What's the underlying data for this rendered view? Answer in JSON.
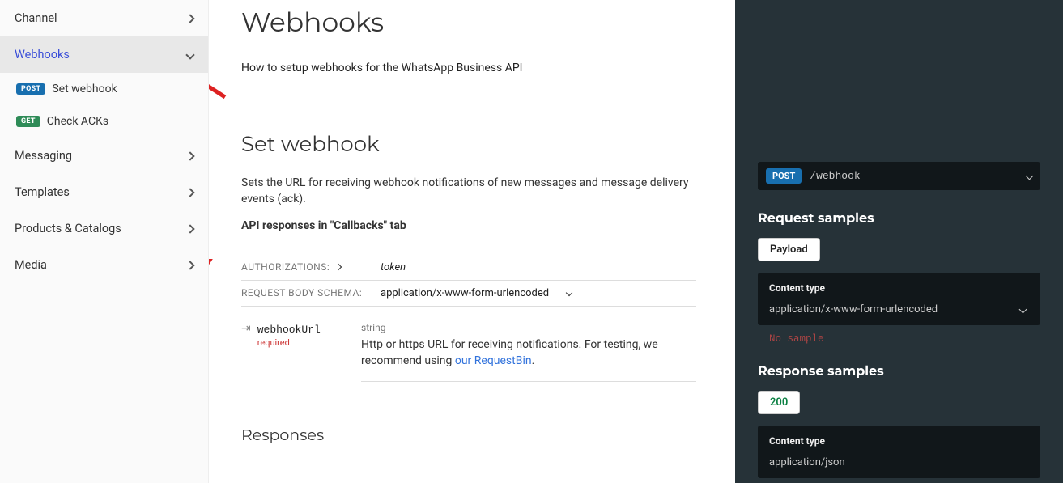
{
  "sidebar": {
    "items": [
      {
        "label": "Channel"
      },
      {
        "label": "Webhooks"
      },
      {
        "label": "Messaging"
      },
      {
        "label": "Templates"
      },
      {
        "label": "Products & Catalogs"
      },
      {
        "label": "Media"
      }
    ],
    "subs": [
      {
        "method": "POST",
        "label": "Set webhook"
      },
      {
        "method": "GET",
        "label": "Check ACKs"
      }
    ]
  },
  "main": {
    "page_title": "Webhooks",
    "intro": "How to setup webhooks for the WhatsApp Business API",
    "section_title": "Set webhook",
    "section_desc": "Sets the URL for receiving webhook notifications of new messages and message delivery events (ack).",
    "strong_line": "API responses in \"Callbacks\" tab",
    "auth_label": "AUTHORIZATIONS:",
    "auth_value": "token",
    "reqbody_label": "REQUEST BODY SCHEMA:",
    "reqbody_value": "application/x-www-form-urlencoded",
    "param_name": "webhookUrl",
    "required": "required",
    "param_type": "string",
    "param_desc_pre": "Http or https URL for receiving notifications. For testing, we recommend using ",
    "param_desc_link": "our RequestBin",
    "param_desc_post": ".",
    "responses_title": "Responses"
  },
  "right": {
    "method": "POST",
    "path": "/webhook",
    "req_samples": "Request samples",
    "payload_tab": "Payload",
    "ct_label": "Content type",
    "ct_value": "application/x-www-form-urlencoded",
    "no_sample": "No sample",
    "resp_samples": "Response samples",
    "code_200": "200",
    "resp_ct_label": "Content type",
    "resp_ct_value": "application/json"
  }
}
